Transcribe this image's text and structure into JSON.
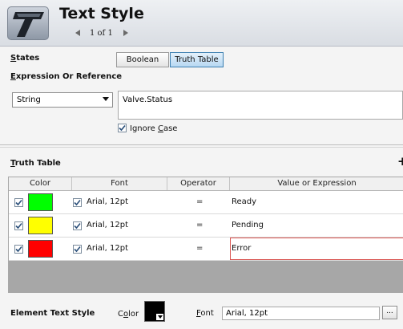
{
  "header": {
    "title": "Text Style",
    "page_indicator": "1 of 1"
  },
  "states": {
    "label": "States",
    "options": [
      "Boolean",
      "Truth Table"
    ],
    "selected": "Truth Table"
  },
  "expression": {
    "label": "Expression Or Reference",
    "type_value": "String",
    "value": "Valve.Status",
    "ignore_case_label": "Ignore Case",
    "ignore_case_checked": true
  },
  "truth_table": {
    "label": "Truth Table",
    "add_symbol": "+",
    "columns": [
      "Color",
      "Font",
      "Operator",
      "Value or Expression"
    ],
    "rows": [
      {
        "enabled": true,
        "color": "#00ff00",
        "font_enabled": true,
        "font": "Arial, 12pt",
        "operator": "=",
        "value": "Ready"
      },
      {
        "enabled": true,
        "color": "#ffff00",
        "font_enabled": true,
        "font": "Arial, 12pt",
        "operator": "=",
        "value": "Pending"
      },
      {
        "enabled": true,
        "color": "#ff0000",
        "font_enabled": true,
        "font": "Arial, 12pt",
        "operator": "=",
        "value": "Error"
      }
    ]
  },
  "element_text_style": {
    "label": "Element Text Style",
    "color_label": "Color",
    "color": "#000000",
    "font_label": "Font",
    "font_value": "Arial, 12pt",
    "browse_label": "..."
  }
}
